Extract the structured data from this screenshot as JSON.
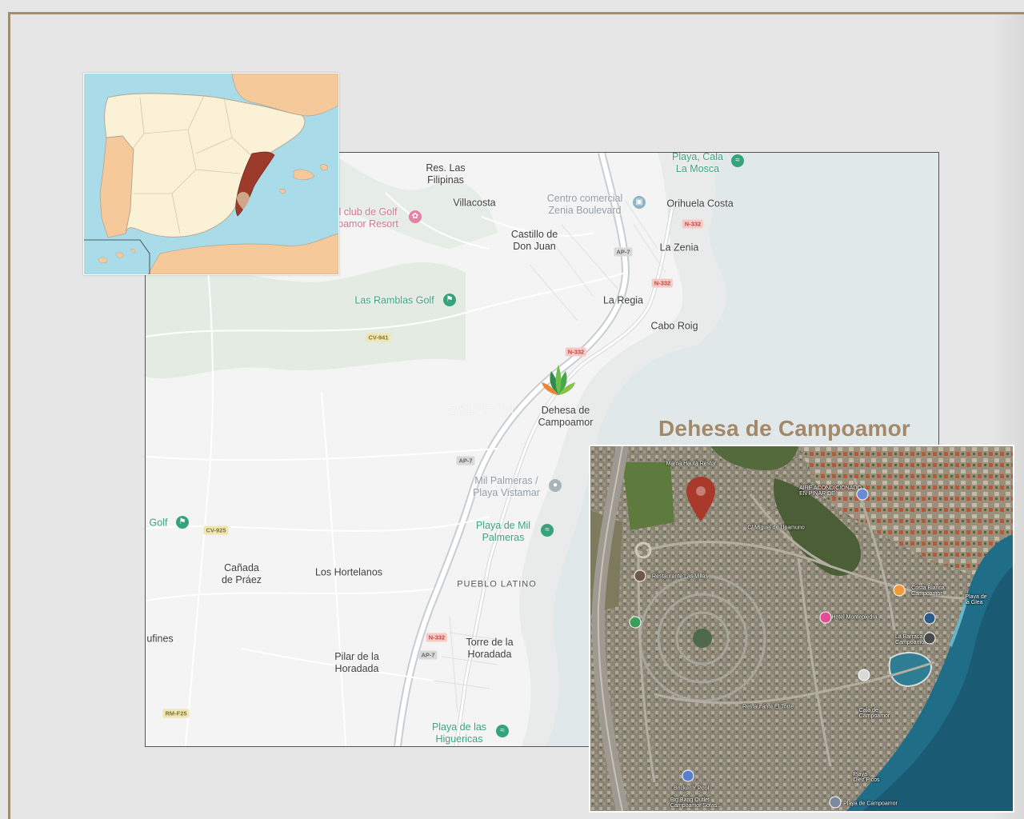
{
  "section_title": "Dehesa de Campoamor",
  "watermark": "B&LPROM",
  "main_map": {
    "places": [
      {
        "text": "Res. Las\nFilipinas",
        "kind": "place"
      },
      {
        "text": "Villacosta",
        "kind": "place"
      },
      {
        "text": "Castillo de\nDon Juan",
        "kind": "place"
      },
      {
        "text": "Orihuela Costa",
        "kind": "place"
      },
      {
        "text": "La Zenia",
        "kind": "place"
      },
      {
        "text": "La Regia",
        "kind": "place"
      },
      {
        "text": "Cabo Roig",
        "kind": "place"
      },
      {
        "text": "Cañada\nde Práez",
        "kind": "place"
      },
      {
        "text": "Los Hortelanos",
        "kind": "place"
      },
      {
        "text": "Pilar de la\nHoradada",
        "kind": "place"
      },
      {
        "text": "Torre de la\nHoradada",
        "kind": "place"
      },
      {
        "text": "ufines",
        "kind": "place"
      },
      {
        "text": "PUEBLO LATINO",
        "kind": "caps"
      },
      {
        "text": "Dehesa de\nCampoamor",
        "kind": "place"
      },
      {
        "text": "Playa, Cala\nLa Mosca",
        "kind": "poi"
      },
      {
        "text": "Centro comercial\nZenia Boulevard",
        "kind": "poi-gray"
      },
      {
        "text": "l club de Golf\npamor Resort",
        "kind": "poi-pink"
      },
      {
        "text": "Las Ramblas Golf",
        "kind": "poi"
      },
      {
        "text": "Mil Palmeras /\nPlaya Vistamar",
        "kind": "poi-gray"
      },
      {
        "text": "Playa de Mil\nPalmeras",
        "kind": "poi"
      },
      {
        "text": "Golf",
        "kind": "poi"
      },
      {
        "text": "Playa de las\nHiguericas",
        "kind": "poi"
      }
    ],
    "road_badges": [
      "AP-7",
      "AP-7",
      "AP-7",
      "N-332",
      "N-332",
      "N-332",
      "N-332",
      "CV-941",
      "CV-925",
      "RM-F25"
    ]
  },
  "satellite": {
    "labels": [
      "Mama Hauta Restor",
      "AIRE ACONDICIONADO\nEN PINAR DE",
      "C/ Miguel de Unamuno",
      "Restaurante Las Villas",
      "Hotel Montepiedra",
      "Costa Blanca\nCampoamor",
      "Playa de\nla Glea",
      "Cala de\nCampoamor",
      "Restaurante El Torre",
      "Playa\nDiez Picos",
      "Playa de Campoamor",
      "Big Bang Outlet\nCampoamor Sofas...",
      "Bricker Y Pool",
      "La Barraca de\nCampoamor"
    ]
  },
  "colors": {
    "title": "#a4886a",
    "frame": "#a48c6f",
    "highlight_region": "#9c3a2b",
    "pin": "#a8392b",
    "poi_green": "#35a37b"
  }
}
